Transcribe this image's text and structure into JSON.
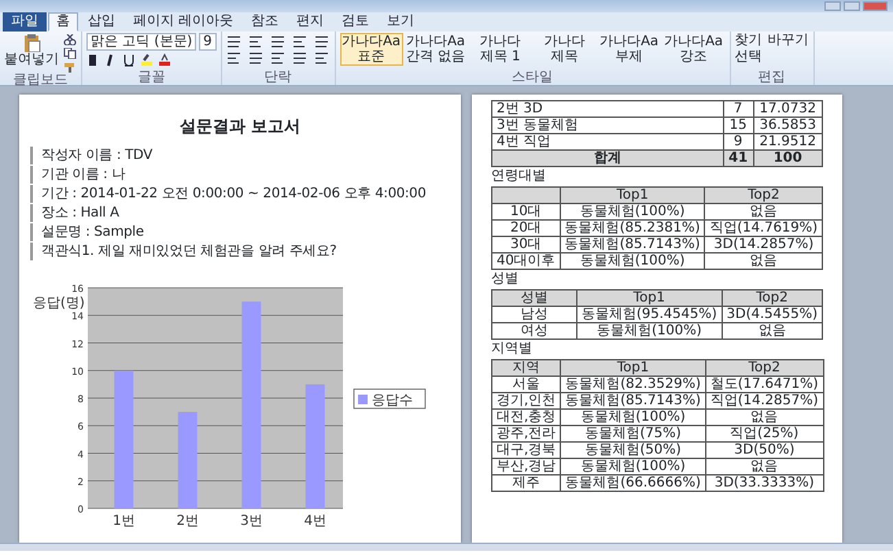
{
  "ribbon": {
    "tabs": [
      {
        "label": "파일",
        "selected": false
      },
      {
        "label": "홈",
        "selected": true
      },
      {
        "label": "삽입",
        "selected": false
      },
      {
        "label": "페이지 레이아웃",
        "selected": false
      },
      {
        "label": "참조",
        "selected": false
      },
      {
        "label": "편지",
        "selected": false
      },
      {
        "label": "검토",
        "selected": false
      },
      {
        "label": "보기",
        "selected": false
      }
    ],
    "clipboard": {
      "paste": "붙여넣기",
      "label": "클립보드"
    },
    "font": {
      "name": "맑은 고딕 (본문)",
      "size": "9",
      "label": "글꼴"
    },
    "paragraph": {
      "label": "단락"
    },
    "styles": {
      "label": "스타일",
      "items": [
        {
          "preview": "가나다Aa",
          "name": "표준",
          "selected": true
        },
        {
          "preview": "가나다Aa",
          "name": "간격 없음",
          "selected": false
        },
        {
          "preview": "가나다",
          "name": "제목 1",
          "selected": false
        },
        {
          "preview": "가나다",
          "name": "제목",
          "selected": false
        },
        {
          "preview": "가나다Aa",
          "name": "부제",
          "selected": false
        },
        {
          "preview": "가나다Aa",
          "name": "강조",
          "selected": false
        }
      ]
    },
    "editing": {
      "label": "편집",
      "items": [
        "찾기",
        "바꾸기",
        "선택"
      ]
    }
  },
  "left_page": {
    "title": "설문결과 보고서",
    "bullets": [
      "작성자 이름 : TDV",
      "기관 이름 : 나",
      "기간 : 2014-01-22 오전 0:00:00 ~ 2014-02-06 오후 4:00:00",
      "장소 : Hall A",
      "설문명 : Sample",
      "객관식1. 제일 재미있었던 체험관을 알려 주세요?"
    ],
    "chart_data": {
      "type": "bar",
      "ylabel": "응답(명)",
      "categories": [
        "1번",
        "2번",
        "3번",
        "4번"
      ],
      "series": [
        {
          "name": "응답수",
          "color": "#9999ff",
          "values": [
            10,
            7,
            15,
            9
          ]
        }
      ],
      "ylim": [
        0,
        16
      ],
      "grid": true,
      "yticks": [
        0,
        2,
        4,
        6,
        8,
        10,
        12,
        14,
        16
      ]
    }
  },
  "right_page": {
    "summary_rows": [
      [
        "2번 3D",
        "7",
        "17.0732"
      ],
      [
        "3번 동물체험",
        "15",
        "36.5853"
      ],
      [
        "4번 직업",
        "9",
        "21.9512"
      ]
    ],
    "summary_total": [
      "합계",
      "41",
      "100"
    ],
    "sections": [
      {
        "label": "연령대별",
        "columns": [
          "",
          "Top1",
          "Top2"
        ],
        "rows": [
          [
            "10대",
            "동물체험(100%)",
            "없음"
          ],
          [
            "20대",
            "동물체험(85.2381%)",
            "직업(14.7619%)"
          ],
          [
            "30대",
            "동물체험(85.7143%)",
            "3D(14.2857%)"
          ],
          [
            "40대이후",
            "동물체험(100%)",
            "없음"
          ]
        ]
      },
      {
        "label": "성별",
        "columns": [
          "성별",
          "Top1",
          "Top2"
        ],
        "rows": [
          [
            "남성",
            "동물체험(95.4545%)",
            "3D(4.5455%)"
          ],
          [
            "여성",
            "동물체험(100%)",
            "없음"
          ]
        ]
      },
      {
        "label": "지역별",
        "columns": [
          "지역",
          "Top1",
          "Top2"
        ],
        "rows": [
          [
            "서울",
            "동물체험(82.3529%)",
            "철도(17.6471%)"
          ],
          [
            "경기,인천",
            "동물체험(85.7143%)",
            "직업(14.2857%)"
          ],
          [
            "대전,충청",
            "동물체험(100%)",
            "없음"
          ],
          [
            "광주,전라",
            "동물체험(75%)",
            "직업(25%)"
          ],
          [
            "대구,경북",
            "동물체험(50%)",
            "3D(50%)"
          ],
          [
            "부산,경남",
            "동물체험(100%)",
            "없음"
          ],
          [
            "제주",
            "동물체험(66.6666%)",
            "3D(33.3333%)"
          ]
        ]
      }
    ]
  }
}
